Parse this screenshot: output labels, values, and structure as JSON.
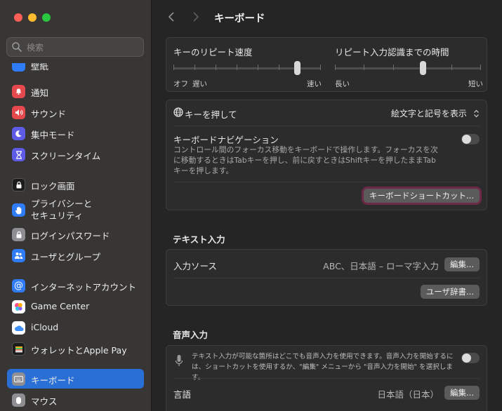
{
  "window": {
    "title": "キーボード"
  },
  "sidebar": {
    "search_placeholder": "検索",
    "partial_item": "壁紙",
    "items": [
      {
        "label": "通知",
        "icon": "bell-icon",
        "color": "#e5484d"
      },
      {
        "label": "サウンド",
        "icon": "speaker-icon",
        "color": "#e5484d"
      },
      {
        "label": "集中モード",
        "icon": "moon-icon",
        "color": "#5e5ce6"
      },
      {
        "label": "スクリーンタイム",
        "icon": "hourglass-icon",
        "color": "#5e5ce6"
      },
      {
        "label": "ロック画面",
        "icon": "lock-screen-icon",
        "color": "#1c1c1c"
      },
      {
        "label": "プライバシーと\nセキュリティ",
        "icon": "hand-icon",
        "color": "#2f7cf6"
      },
      {
        "label": "ログインパスワード",
        "icon": "lock-icon",
        "color": "#8e8e93"
      },
      {
        "label": "ユーザとグループ",
        "icon": "users-icon",
        "color": "#2f7cf6"
      },
      {
        "label": "インターネットアカウント",
        "icon": "at-icon",
        "color": "#2f7cf6"
      },
      {
        "label": "Game Center",
        "icon": "game-center-icon",
        "color": "#ffffff"
      },
      {
        "label": "iCloud",
        "icon": "cloud-icon",
        "color": "#ffffff"
      },
      {
        "label": "ウォレットとApple Pay",
        "icon": "wallet-icon",
        "color": "#1c1c1c"
      },
      {
        "label": "キーボード",
        "icon": "keyboard-icon",
        "color": "#8e8e93",
        "active": true
      },
      {
        "label": "マウス",
        "icon": "mouse-icon",
        "color": "#8e8e93"
      }
    ]
  },
  "main": {
    "repeat": {
      "rate_label": "キーのリピート速度",
      "rate_min": "オフ",
      "rate_slow": "遅い",
      "rate_fast": "速い",
      "rate_value": 0.84,
      "delay_label": "リピート入力認識までの時間",
      "delay_long": "長い",
      "delay_short": "短い",
      "delay_value": 0.6
    },
    "globe": {
      "label": "キーを押して",
      "value": "絵文字と記号を表示"
    },
    "nav": {
      "label": "キーボードナビゲーション",
      "desc": "コントロール間のフォーカス移動をキーボードで操作します。フォーカスを次に移動するときはTabキーを押し、前に戻すときはShiftキーを押したままTabキーを押します。",
      "enabled": false
    },
    "shortcuts_button": "キーボードショートカット...",
    "text_input": {
      "title": "テキスト入力",
      "source_label": "入力ソース",
      "source_value": "ABC、日本語 – ローマ字入力",
      "edit_button": "編集...",
      "dictionary_button": "ユーザ辞書..."
    },
    "dictation": {
      "title": "音声入力",
      "desc": "テキスト入力が可能な箇所はどこでも音声入力を使用できます。音声入力を開始するには、ショートカットを使用するか、\"編集\" メニューから \"音声入力を開始\" を選択します。",
      "enabled": false,
      "language_label": "言語",
      "language_value": "日本語（日本）",
      "edit_button": "編集..."
    }
  }
}
